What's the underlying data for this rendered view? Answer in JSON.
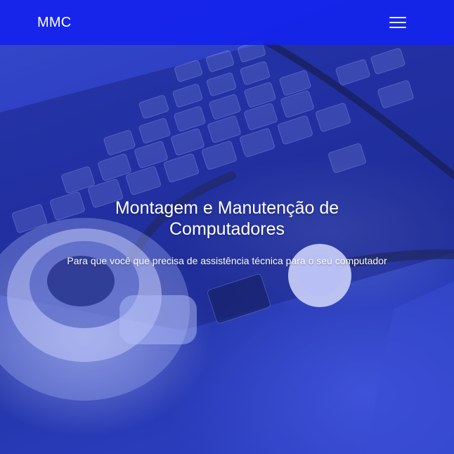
{
  "navbar": {
    "brand": "MMC",
    "menu_icon": "hamburger-menu-icon"
  },
  "hero": {
    "title": "Montagem e Manutenção de Computadores",
    "subtitle": "Para que você que precisa de assistência técnica para o seu computador"
  },
  "colors": {
    "navbar_bg": "#1423eb",
    "overlay_tint": "#2a3bb8",
    "text": "#ffffff"
  }
}
